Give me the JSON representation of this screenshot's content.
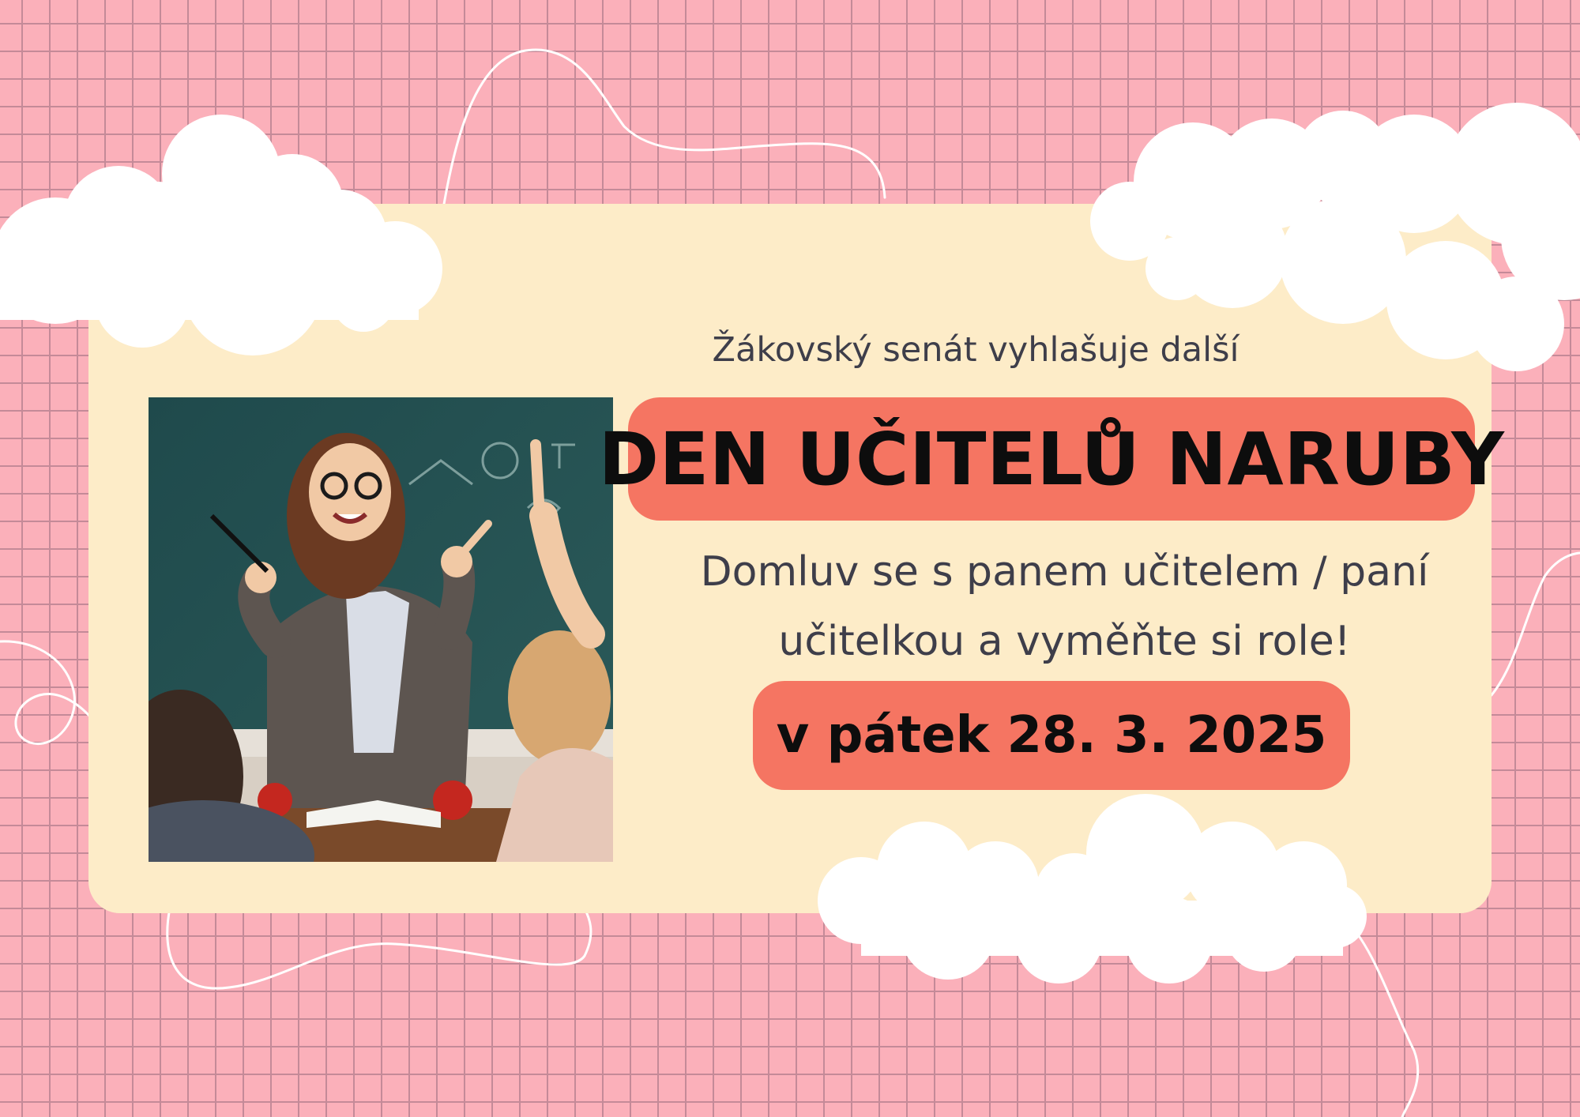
{
  "poster": {
    "intro": "Žákovský senát vyhlašuje další",
    "title": "DEN UČITELŮ NARUBY",
    "message_line1": "Domluv se s panem učitelem / paní",
    "message_line2": "učitelkou a vyměňte si role!",
    "date": "v pátek 28. 3. 2025"
  },
  "colors": {
    "background": "#fbb0ba",
    "grid_lines": "#c48a98",
    "card": "#fdecc8",
    "pill": "#f57562",
    "cloud": "#ffffff",
    "text_dark": "#0d0d0d",
    "text_body": "#3e3e4a"
  },
  "illustration": {
    "subject": "teacher-with-pencils-and-raised-hand-student-illustration"
  }
}
